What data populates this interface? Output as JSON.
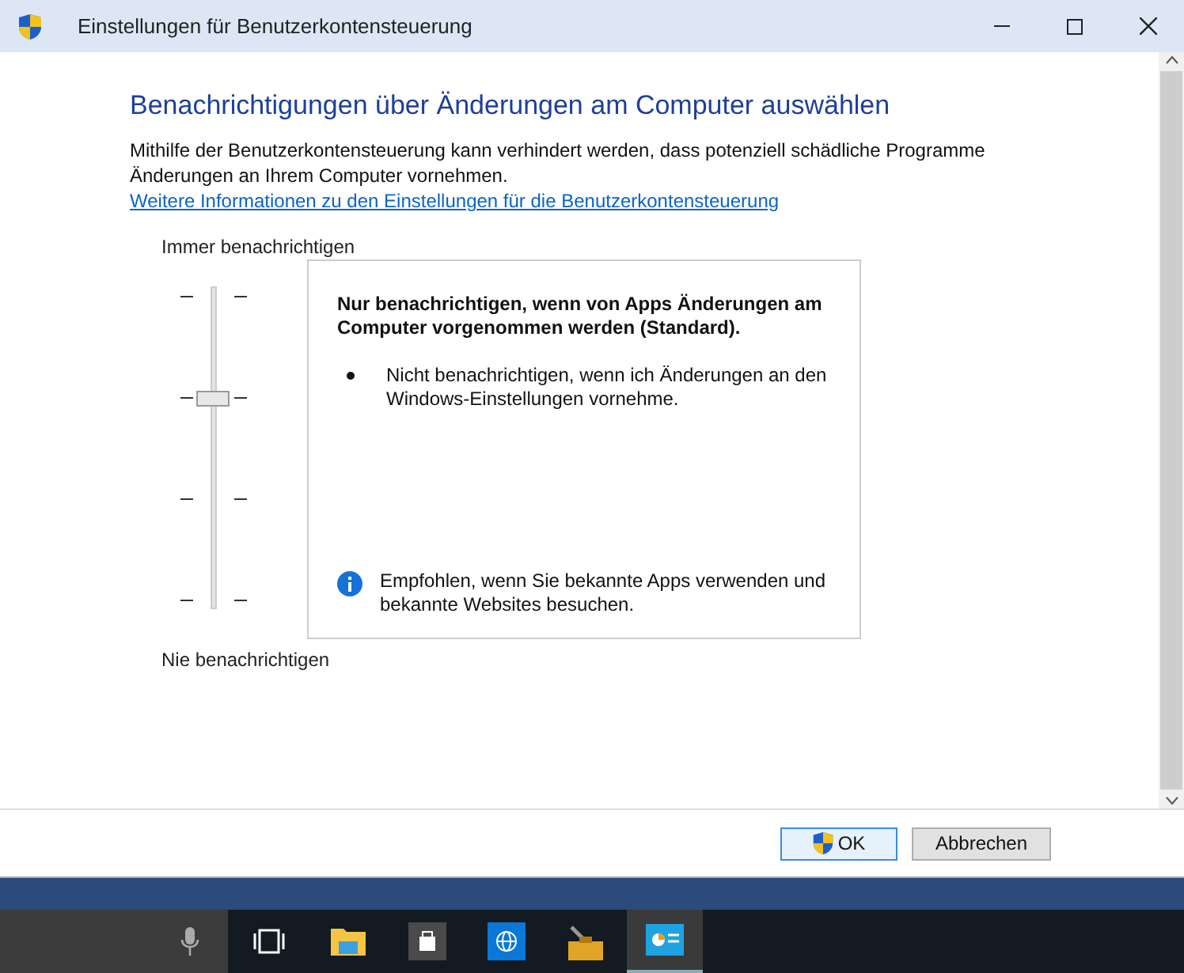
{
  "window": {
    "title": "Einstellungen für Benutzerkontensteuerung"
  },
  "heading": "Benachrichtigungen über Änderungen am Computer auswählen",
  "description": "Mithilfe der Benutzerkontensteuerung kann verhindert werden, dass potenziell schädliche Programme Änderungen an Ihrem Computer vornehmen.",
  "info_link": "Weitere Informationen zu den Einstellungen für die Benutzerkontensteuerung",
  "slider": {
    "top_label": "Immer benachrichtigen",
    "bottom_label": "Nie benachrichtigen",
    "level": 0.667
  },
  "details": {
    "title": "Nur benachrichtigen, wenn von Apps Änderungen am Computer vorgenommen werden (Standard).",
    "bullets": [
      "Nicht benachrichtigen, wenn ich Änderungen an den Windows-Einstellungen vornehme."
    ],
    "recommendation": "Empfohlen, wenn Sie bekannte Apps verwenden und bekannte Websites besuchen."
  },
  "buttons": [
    {
      "label": "OK",
      "kind": "shield"
    },
    {
      "label": "Abbrechen",
      "kind": "plain"
    }
  ],
  "taskbar": {
    "items": [
      {
        "kind": "mic",
        "selected": false
      },
      {
        "kind": "taskview",
        "selected": false
      },
      {
        "kind": "folder",
        "selected": false
      },
      {
        "kind": "store",
        "selected": false
      },
      {
        "kind": "globe",
        "selected": false
      },
      {
        "kind": "toolbox",
        "selected": false
      },
      {
        "kind": "panel",
        "selected": true
      }
    ]
  }
}
